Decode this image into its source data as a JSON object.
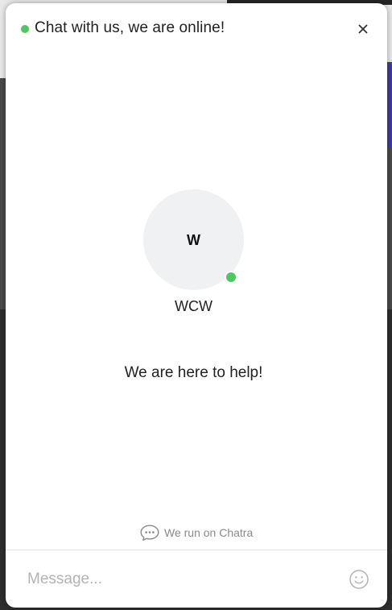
{
  "colors": {
    "online": "#4cc95e",
    "text": "#222222",
    "muted": "#8a8a8a",
    "placeholder": "#b3b3b3",
    "avatar_bg": "#f0f1f3"
  },
  "header": {
    "status_text": "Chat with us, we are online!",
    "close_icon": "close-icon"
  },
  "agent": {
    "initial": "W",
    "name": "WCW",
    "status": "online"
  },
  "greeting": "We are here to help!",
  "footer": {
    "powered_text": "We run on Chatra",
    "powered_icon": "chat-bubbles-icon"
  },
  "composer": {
    "value": "",
    "placeholder": "Message...",
    "emoji_icon": "smiley-icon"
  }
}
